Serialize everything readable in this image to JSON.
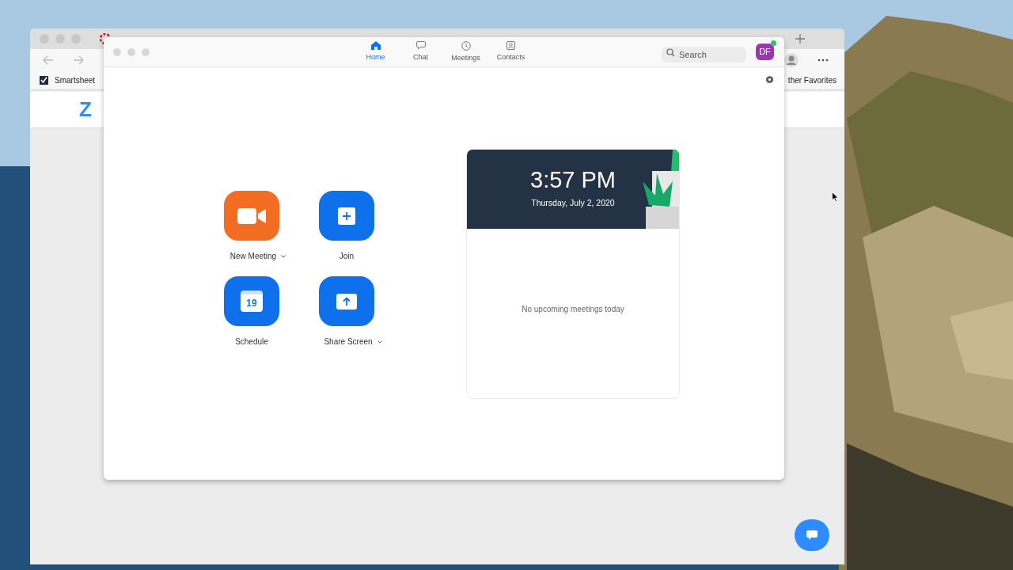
{
  "browser": {
    "bookmarks": [
      {
        "label": "Smartsheet"
      }
    ],
    "other_favorites": "ther Favorites",
    "page_logo": "Z"
  },
  "zoom": {
    "nav": [
      {
        "label": "Home",
        "kind": "home",
        "selected": true
      },
      {
        "label": "Chat",
        "kind": "chat",
        "selected": false
      },
      {
        "label": "Meetings",
        "kind": "clock",
        "selected": false
      },
      {
        "label": "Contacts",
        "kind": "contact",
        "selected": false
      }
    ],
    "search": {
      "placeholder": "Search"
    },
    "avatar": {
      "initials": "DF",
      "online": true
    },
    "actions": [
      {
        "label": "New Meeting",
        "kind": "camera",
        "color": "#f26d21",
        "dropdown": true
      },
      {
        "label": "Join",
        "kind": "plus",
        "color": "#0e71eb",
        "dropdown": false
      },
      {
        "label": "Schedule",
        "kind": "calendar",
        "icon_text": "19",
        "color": "#0e71eb",
        "dropdown": false
      },
      {
        "label": "Share Screen",
        "kind": "share",
        "color": "#0e71eb",
        "dropdown": true
      }
    ],
    "clock": {
      "time": "3:57 PM",
      "date": "Thursday, July 2, 2020"
    },
    "schedule_empty": "No upcoming meetings today"
  }
}
